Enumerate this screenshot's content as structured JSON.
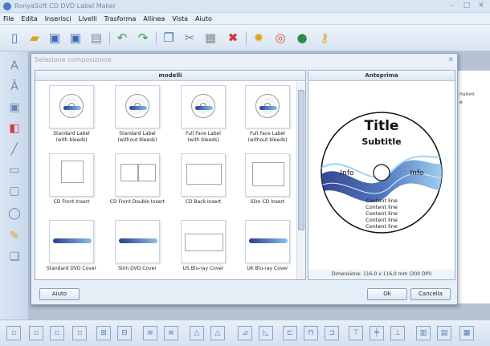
{
  "app": {
    "title": "RonyaSoft CD DVD Label Maker"
  },
  "menu": [
    "File",
    "Edita",
    "Inserisci",
    "Livelli",
    "Trasforma",
    "Allinea",
    "Vista",
    "Aiuto"
  ],
  "toolbar_icons": [
    "new-icon",
    "open-icon",
    "save-icon",
    "save-as-icon",
    "print-icon",
    "undo-icon",
    "redo-icon",
    "copy-icon",
    "cut-icon",
    "paste-icon",
    "delete-icon",
    "settings-icon",
    "help-icon",
    "web-icon",
    "key-icon"
  ],
  "dialog": {
    "title": "Selezione composizione",
    "models_header": "modelli",
    "preview_header": "Anteprima",
    "templates": [
      {
        "label": "Standard Label\n(with bleeds)"
      },
      {
        "label": "Standard Label\n(without bleeds)"
      },
      {
        "label": "Full Face Label\n(with bleeds)"
      },
      {
        "label": "Full Face Label\n(without bleeds)"
      },
      {
        "label": "CD Front Insert"
      },
      {
        "label": "CD Front Double Insert"
      },
      {
        "label": "CD Back Insert"
      },
      {
        "label": "Slim CD Insert"
      },
      {
        "label": "Standard DVD Cover"
      },
      {
        "label": "Slim DVD Cover"
      },
      {
        "label": "US Blu-ray Cover"
      },
      {
        "label": "UK Blu-ray Cover"
      }
    ],
    "preview": {
      "title": "Title",
      "subtitle": "Subtitle",
      "info_left": "Info",
      "info_right": "Info",
      "content_lines": [
        "Content line",
        "Content line",
        "Content line",
        "Content line",
        "Content line"
      ]
    },
    "dimension": "Dimensione: 116,0 x 116,0 mm (300 DPI)",
    "buttons": {
      "help": "Aiuto",
      "ok": "Ok",
      "cancel": "Cancella"
    }
  },
  "right_panel": {
    "text1": "nuovo",
    "text2": "e"
  },
  "colors": {
    "accent": "#2b3f8e",
    "wave_light": "#89c2ea",
    "toolbar_bg": "#dfe9f5"
  }
}
